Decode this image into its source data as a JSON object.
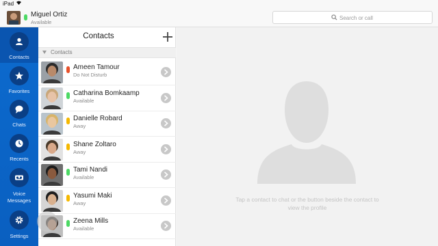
{
  "statusbar": {
    "device": "iPad",
    "wifi_icon": "wifi-icon"
  },
  "header": {
    "user_name": "Miguel Ortiz",
    "user_status": "Available",
    "presence_color": "#4cd964",
    "search_placeholder": "Search or call"
  },
  "nav": {
    "items": [
      {
        "label": "Contacts",
        "icon": "person-icon",
        "active": true
      },
      {
        "label": "Favorites",
        "icon": "star-icon",
        "active": false
      },
      {
        "label": "Chats",
        "icon": "chat-bubble-icon",
        "active": false
      },
      {
        "label": "Recents",
        "icon": "clock-icon",
        "active": false
      },
      {
        "label": "Voice\nMessages",
        "label_line1": "Voice",
        "label_line2": "Messages",
        "icon": "voicemail-icon",
        "active": false
      },
      {
        "label": "Settings",
        "icon": "gear-icon",
        "active": false
      }
    ]
  },
  "contacts": {
    "title": "Contacts",
    "add_icon": "plus-icon",
    "section_label": "Contacts",
    "items": [
      {
        "name": "Ameen Tamour",
        "status": "Do Not Disturb",
        "presence": "#e8502a"
      },
      {
        "name": "Catharina Bomkaamp",
        "status": "Available",
        "presence": "#4cd964"
      },
      {
        "name": "Danielle Robard",
        "status": "Away",
        "presence": "#f5b800"
      },
      {
        "name": "Shane Zoltaro",
        "status": "Away",
        "presence": "#f5b800"
      },
      {
        "name": "Tami Nandi",
        "status": "Available",
        "presence": "#4cd964"
      },
      {
        "name": "Yasumi Maki",
        "status": "Away",
        "presence": "#f5b800"
      },
      {
        "name": "Zeena Mills",
        "status": "Available",
        "presence": "#4cd964"
      }
    ]
  },
  "detail": {
    "placeholder_icon": "person-silhouette-icon",
    "hint": "Tap a contact to chat or the button beside the contact to view the profile"
  },
  "colors": {
    "accent": "#0c6bcf",
    "rail_icon_bg": "#0a3f86"
  }
}
